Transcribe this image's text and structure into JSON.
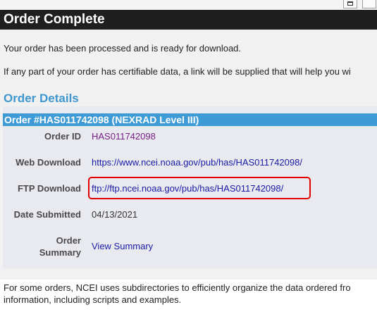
{
  "page": {
    "title": "Order Complete",
    "intro_1": "Your order has been processed and is ready for download.",
    "intro_2": "If any part of your order has certifiable data, a link will be supplied that will help you wi",
    "details_title": "Order Details"
  },
  "order": {
    "header": "Order #HAS011742098 (NEXRAD Level III)",
    "fields": [
      {
        "label": "Order ID",
        "value": "HAS011742098"
      },
      {
        "label": "Web Download",
        "value": "https://www.ncei.noaa.gov/pub/has/HAS011742098/"
      },
      {
        "label": "FTP Download",
        "value": "ftp://ftp.ncei.noaa.gov/pub/has/HAS011742098/"
      },
      {
        "label": "Date Submitted",
        "value": "04/13/2021"
      },
      {
        "label_line1": "Order",
        "label_line2": "Summary",
        "value": "View Summary"
      }
    ]
  },
  "footer": {
    "line_1": "For some orders, NCEI uses subdirectories to efficiently organize the data ordered fro",
    "line_2": "information, including scripts and examples."
  },
  "colors": {
    "header_bg": "#1f1f1f",
    "accent_blue": "#3e9bd6",
    "link": "#1a1aa6",
    "order_id": "#7a1f86",
    "highlight": "#e00000"
  }
}
